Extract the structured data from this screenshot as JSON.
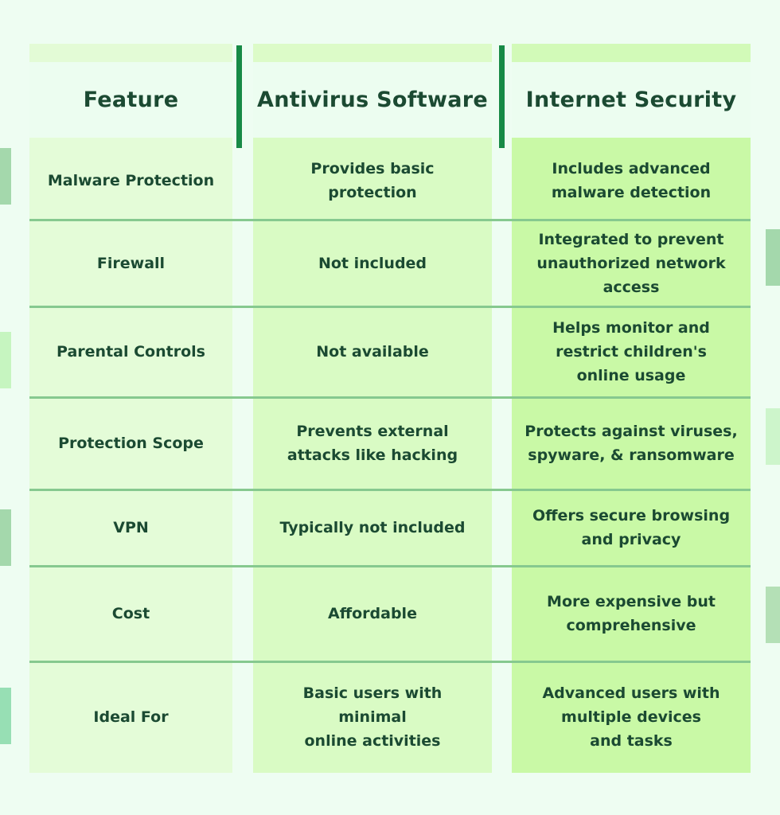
{
  "table": {
    "headers": [
      "Feature",
      "Antivirus Software",
      "Internet Security"
    ],
    "rows": [
      {
        "feature": "Malware Protection",
        "antivirus": "Provides basic\nprotection",
        "internet_security": "Includes advanced\nmalware detection"
      },
      {
        "feature": "Firewall",
        "antivirus": "Not included",
        "internet_security": "Integrated to prevent\nunauthorized network\naccess"
      },
      {
        "feature": "Parental Controls",
        "antivirus": "Not available",
        "internet_security": "Helps monitor and\nrestrict children's\nonline usage"
      },
      {
        "feature": "Protection Scope",
        "antivirus": "Prevents external\nattacks like hacking",
        "internet_security": "Protects against viruses,\nspyware, & ransomware"
      },
      {
        "feature": "VPN",
        "antivirus": "Typically not included",
        "internet_security": "Offers secure browsing\nand privacy"
      },
      {
        "feature": "Cost",
        "antivirus": "Affordable",
        "internet_security": "More expensive but\ncomprehensive"
      },
      {
        "feature": "Ideal For",
        "antivirus": "Basic users with\nminimal\nonline activities",
        "internet_security": "Advanced users with\nmultiple devices\nand tasks"
      }
    ]
  },
  "colors": {
    "background": "#eefdf2",
    "text": "#1b4a32",
    "divider": "#178a46",
    "row_line": "#86c98f",
    "feature_col": "#e4fcd8",
    "antivirus_col": "#d9fbc4",
    "internet_security_col": "#c9f9a6"
  }
}
